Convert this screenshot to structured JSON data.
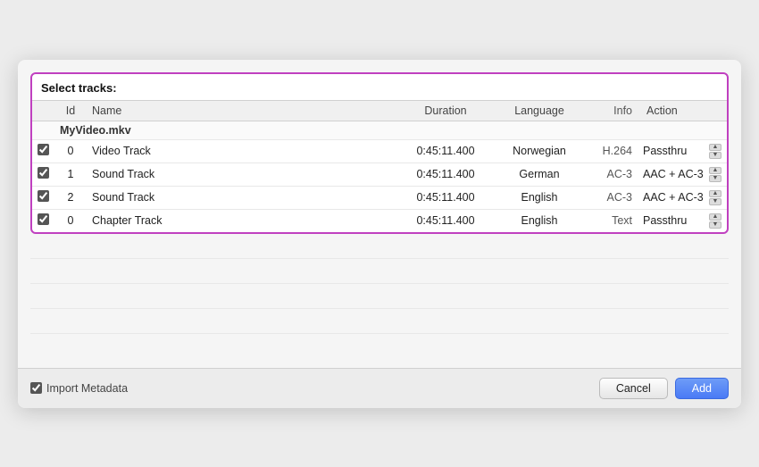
{
  "dialog": {
    "section_title": "Select tracks:",
    "table": {
      "headers": {
        "id": "Id",
        "name": "Name",
        "duration": "Duration",
        "language": "Language",
        "info": "Info",
        "action": "Action"
      },
      "file_row": {
        "filename": "MyVideo.mkv"
      },
      "tracks": [
        {
          "checked": true,
          "id": "0",
          "name": "Video Track",
          "duration": "0:45:11.400",
          "language": "Norwegian",
          "info": "H.264",
          "action": "Passthru"
        },
        {
          "checked": true,
          "id": "1",
          "name": "Sound Track",
          "duration": "0:45:11.400",
          "language": "German",
          "info": "AC-3",
          "action": "AAC + AC-3"
        },
        {
          "checked": true,
          "id": "2",
          "name": "Sound Track",
          "duration": "0:45:11.400",
          "language": "English",
          "info": "AC-3",
          "action": "AAC + AC-3"
        },
        {
          "checked": true,
          "id": "0",
          "name": "Chapter Track",
          "duration": "0:45:11.400",
          "language": "English",
          "info": "Text",
          "action": "Passthru"
        }
      ]
    },
    "footer": {
      "import_metadata_label": "Import Metadata",
      "import_metadata_checked": true,
      "cancel_label": "Cancel",
      "add_label": "Add"
    }
  }
}
